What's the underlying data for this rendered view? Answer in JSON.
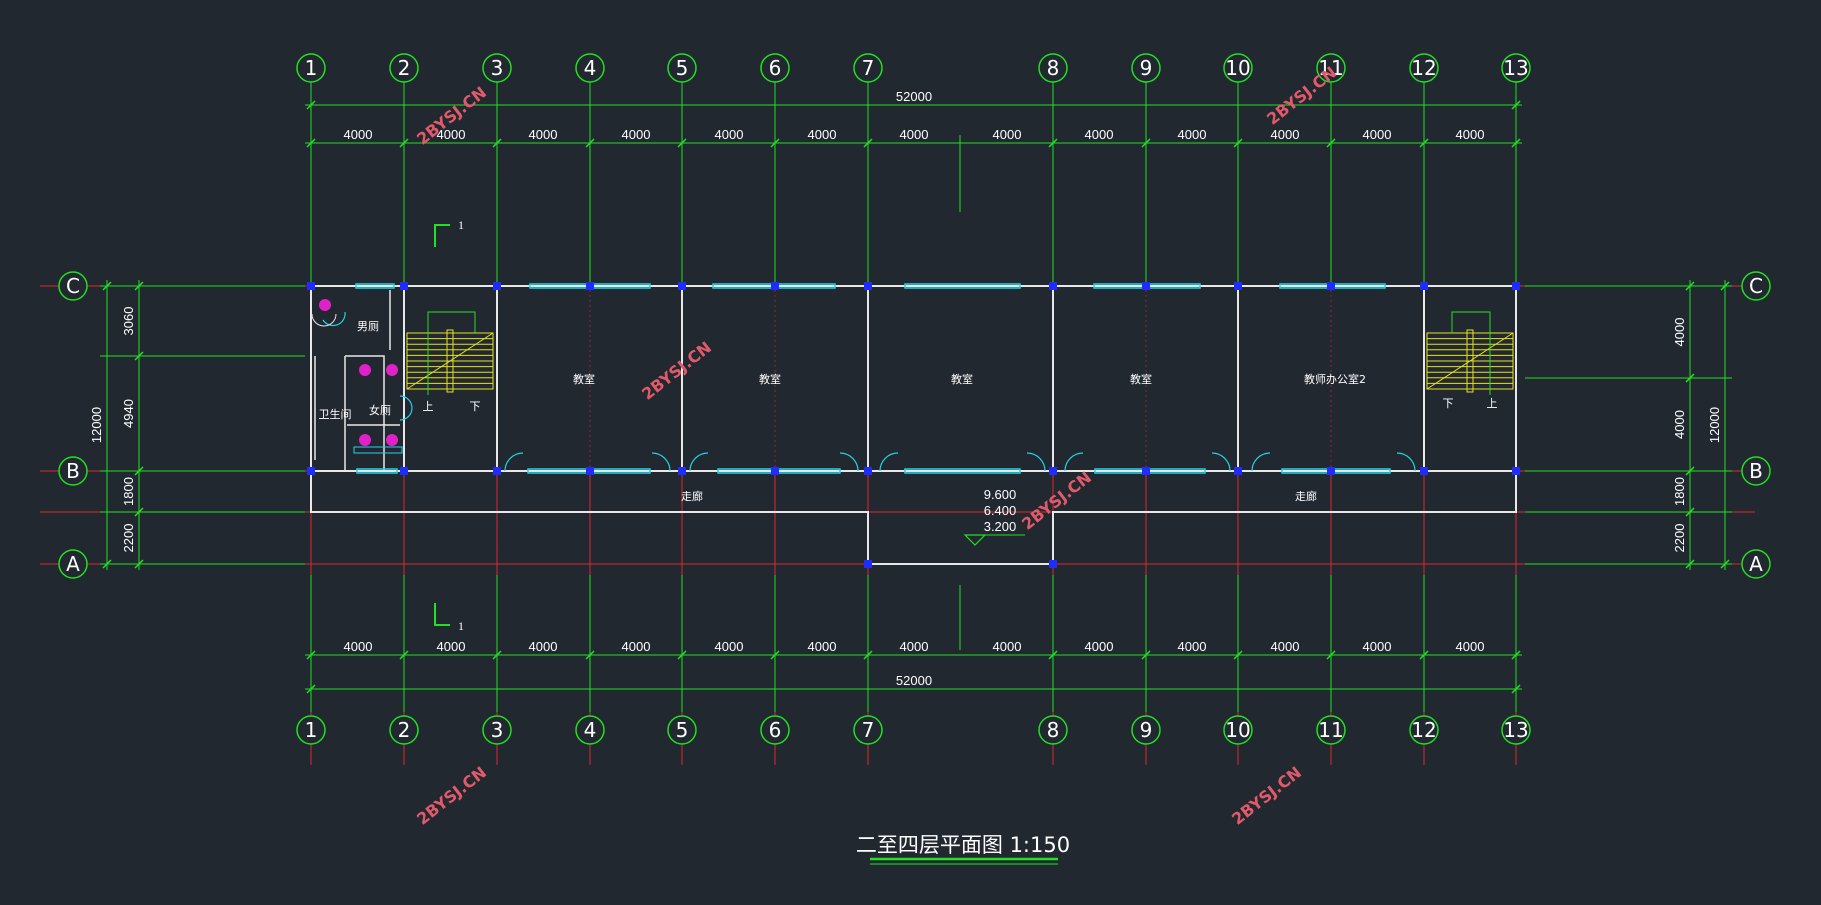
{
  "drawing": {
    "title": "二至四层平面图 1:150",
    "watermark": "2BYSJ.CN",
    "column_axes": [
      "1",
      "2",
      "3",
      "4",
      "5",
      "6",
      "7",
      "8",
      "9",
      "10",
      "11",
      "12",
      "13"
    ],
    "row_axes": [
      "C",
      "B",
      "A"
    ],
    "top_spans": [
      "4000",
      "4000",
      "4000",
      "4000",
      "4000",
      "4000",
      "4000",
      "4000",
      "4000",
      "4000",
      "4000",
      "4000",
      "4000"
    ],
    "bottom_spans": [
      "4000",
      "4000",
      "4000",
      "4000",
      "4000",
      "4000",
      "4000",
      "4000",
      "4000",
      "4000",
      "4000",
      "4000",
      "4000"
    ],
    "total_length": "52000",
    "left_dims": [
      "3060",
      "4940",
      "1800",
      "2200"
    ],
    "right_dims": [
      "4000",
      "4000",
      "1800",
      "2200"
    ],
    "total_depth": "12000",
    "rooms": [
      "教室",
      "教室",
      "教室",
      "教室",
      "教师办公室2"
    ],
    "corridor_label": "走廊",
    "restroom_labels": [
      "卫生间",
      "女厕",
      "男厕"
    ],
    "stair_labels": {
      "up": "上",
      "down": "下"
    },
    "elevations": [
      "9.600",
      "6.400",
      "3.200"
    ],
    "section_mark": "1"
  },
  "colors": {
    "background": "#212830",
    "axis_line": "#e0262f",
    "dimension_line": "#22e022",
    "wall": "#e8e8e8",
    "window": "#22d4e8",
    "column": "#1f2cff",
    "stair": "#e8e020",
    "door": "#22d4e8",
    "fixture": "#e020c8",
    "watermark": "#e05a6a"
  }
}
